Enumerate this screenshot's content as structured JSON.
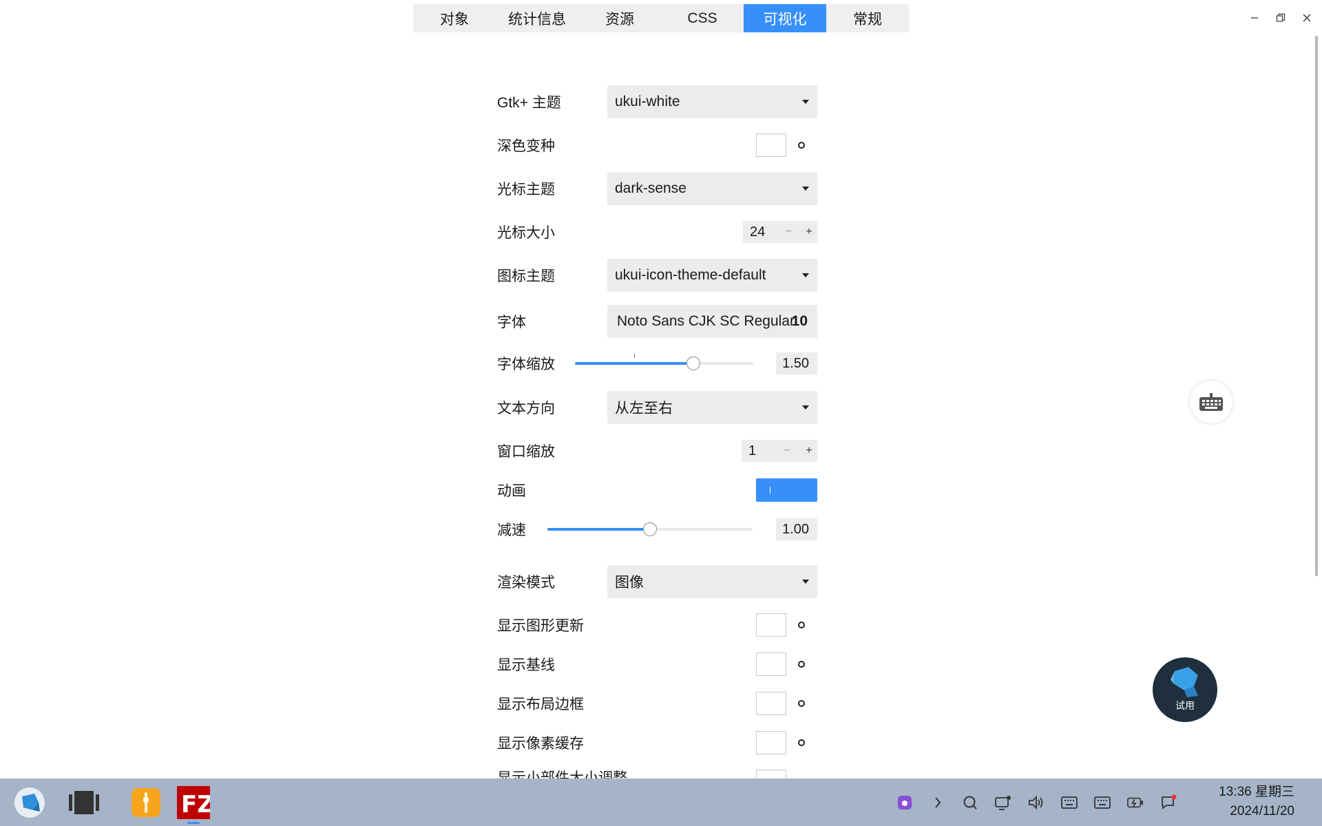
{
  "tabs": [
    {
      "label": "对象",
      "active": false
    },
    {
      "label": "统计信息",
      "active": false
    },
    {
      "label": "资源",
      "active": false
    },
    {
      "label": "CSS",
      "active": false
    },
    {
      "label": "可视化",
      "active": true
    },
    {
      "label": "常规",
      "active": false
    }
  ],
  "window_controls": {
    "minimize": "–",
    "restore": "⧉",
    "close": "✕"
  },
  "settings": {
    "gtk_theme": {
      "label": "Gtk+ 主题",
      "value": "ukui-white"
    },
    "dark_variant": {
      "label": "深色变种",
      "checked": false
    },
    "cursor_theme": {
      "label": "光标主题",
      "value": "dark-sense"
    },
    "cursor_size": {
      "label": "光标大小",
      "value": "24",
      "minus": "−",
      "plus": "+"
    },
    "icon_theme": {
      "label": "图标主题",
      "value": "ukui-icon-theme-default"
    },
    "font": {
      "label": "字体",
      "family": "Noto Sans CJK SC Regular",
      "size": "10"
    },
    "font_scale": {
      "label": "字体缩放",
      "value": "1.50",
      "fraction": 0.66
    },
    "text_direction": {
      "label": "文本方向",
      "value": "从左至右"
    },
    "window_scale": {
      "label": "窗口缩放",
      "value": "1",
      "minus": "−",
      "plus": "+"
    },
    "animation": {
      "label": "动画",
      "on": true
    },
    "slowdown": {
      "label": "减速",
      "value": "1.00",
      "fraction": 0.5
    },
    "render_mode": {
      "label": "渲染模式",
      "value": "图像"
    },
    "show_graphic_updates": {
      "label": "显示图形更新",
      "checked": false
    },
    "show_baselines": {
      "label": "显示基线",
      "checked": false
    },
    "show_layout_borders": {
      "label": "显示布局边框",
      "checked": false
    },
    "show_pixel_cache": {
      "label": "显示像素缓存",
      "checked": false
    },
    "show_widget_resize": {
      "label": "显示小部件大小调整"
    }
  },
  "floating": {
    "trial_label": "试用"
  },
  "taskbar": {
    "apps": [
      "kylin-start",
      "multitask-view",
      "file-manager",
      "filezilla"
    ],
    "clock_time": "13:36 星期三",
    "clock_date": "2024/11/20"
  },
  "colors": {
    "accent": "#3790fa",
    "taskbar": "#a5b4c8"
  }
}
